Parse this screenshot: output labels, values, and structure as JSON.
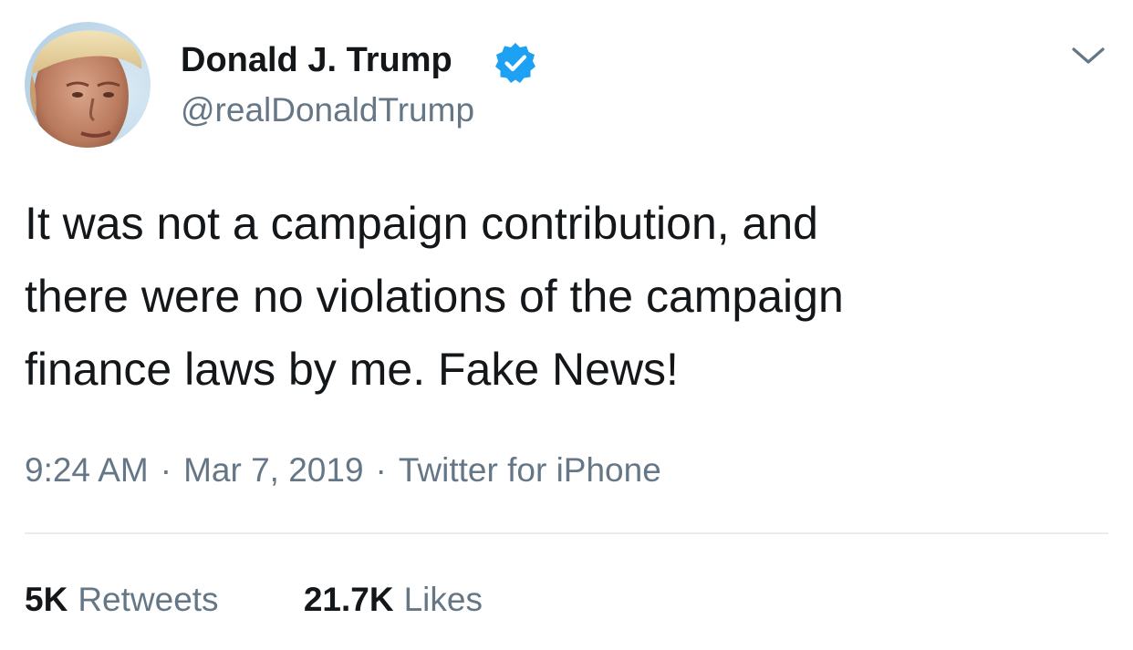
{
  "author": {
    "name": "Donald J. Trump",
    "handle": "@realDonaldTrump",
    "verified": true,
    "avatar_icon": "profile-photo",
    "verified_icon": "verified-check-icon"
  },
  "tweet": {
    "lines": [
      "It was not a campaign contribution, and",
      "there were no violations of the campaign",
      "finance laws by me. Fake News!"
    ]
  },
  "meta": {
    "time": "9:24 AM",
    "separator": "·",
    "date": "Mar 7, 2019",
    "source": "Twitter for iPhone"
  },
  "engagement": {
    "retweets_count": "5K",
    "retweets_label": "Retweets",
    "likes_count": "21.7K",
    "likes_label": "Likes"
  },
  "menu": {
    "icon": "chevron-down-icon"
  },
  "colors": {
    "text_primary": "#14171a",
    "text_secondary": "#657786",
    "verified_blue": "#1da1f2",
    "divider": "#e6ecf0"
  }
}
